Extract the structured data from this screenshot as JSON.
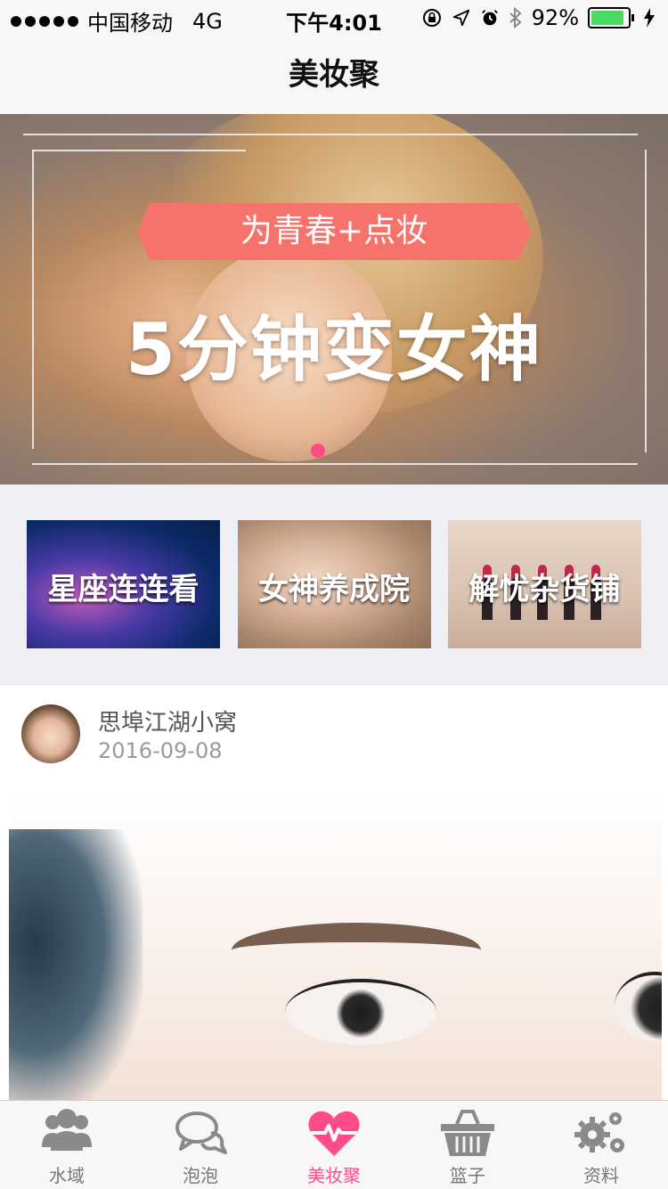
{
  "status_bar": {
    "carrier": "中国移动",
    "network": "4G",
    "time": "下午4:01",
    "battery_text": "92%",
    "battery_level": 0.92
  },
  "nav": {
    "title": "美妆聚"
  },
  "banner": {
    "ribbon_text": "为青春+点妆",
    "headline": "5分钟变女神",
    "page_count": 1,
    "active_page": 1
  },
  "categories": [
    {
      "label": "星座连连看"
    },
    {
      "label": "女神养成院"
    },
    {
      "label": "解忧杂货铺"
    }
  ],
  "post": {
    "author": "思埠江湖小窝",
    "date": "2016-09-08"
  },
  "tabs": [
    {
      "label": "水域",
      "icon": "users-icon"
    },
    {
      "label": "泡泡",
      "icon": "chat-bubbles-icon"
    },
    {
      "label": "美妆聚",
      "icon": "heart-pulse-icon",
      "active": true
    },
    {
      "label": "篮子",
      "icon": "basket-icon"
    },
    {
      "label": "资料",
      "icon": "gears-icon"
    }
  ],
  "colors": {
    "accent": "#ff4b86",
    "ribbon": "#f5736b",
    "battery": "#4cd964",
    "tab_inactive": "#777777"
  }
}
